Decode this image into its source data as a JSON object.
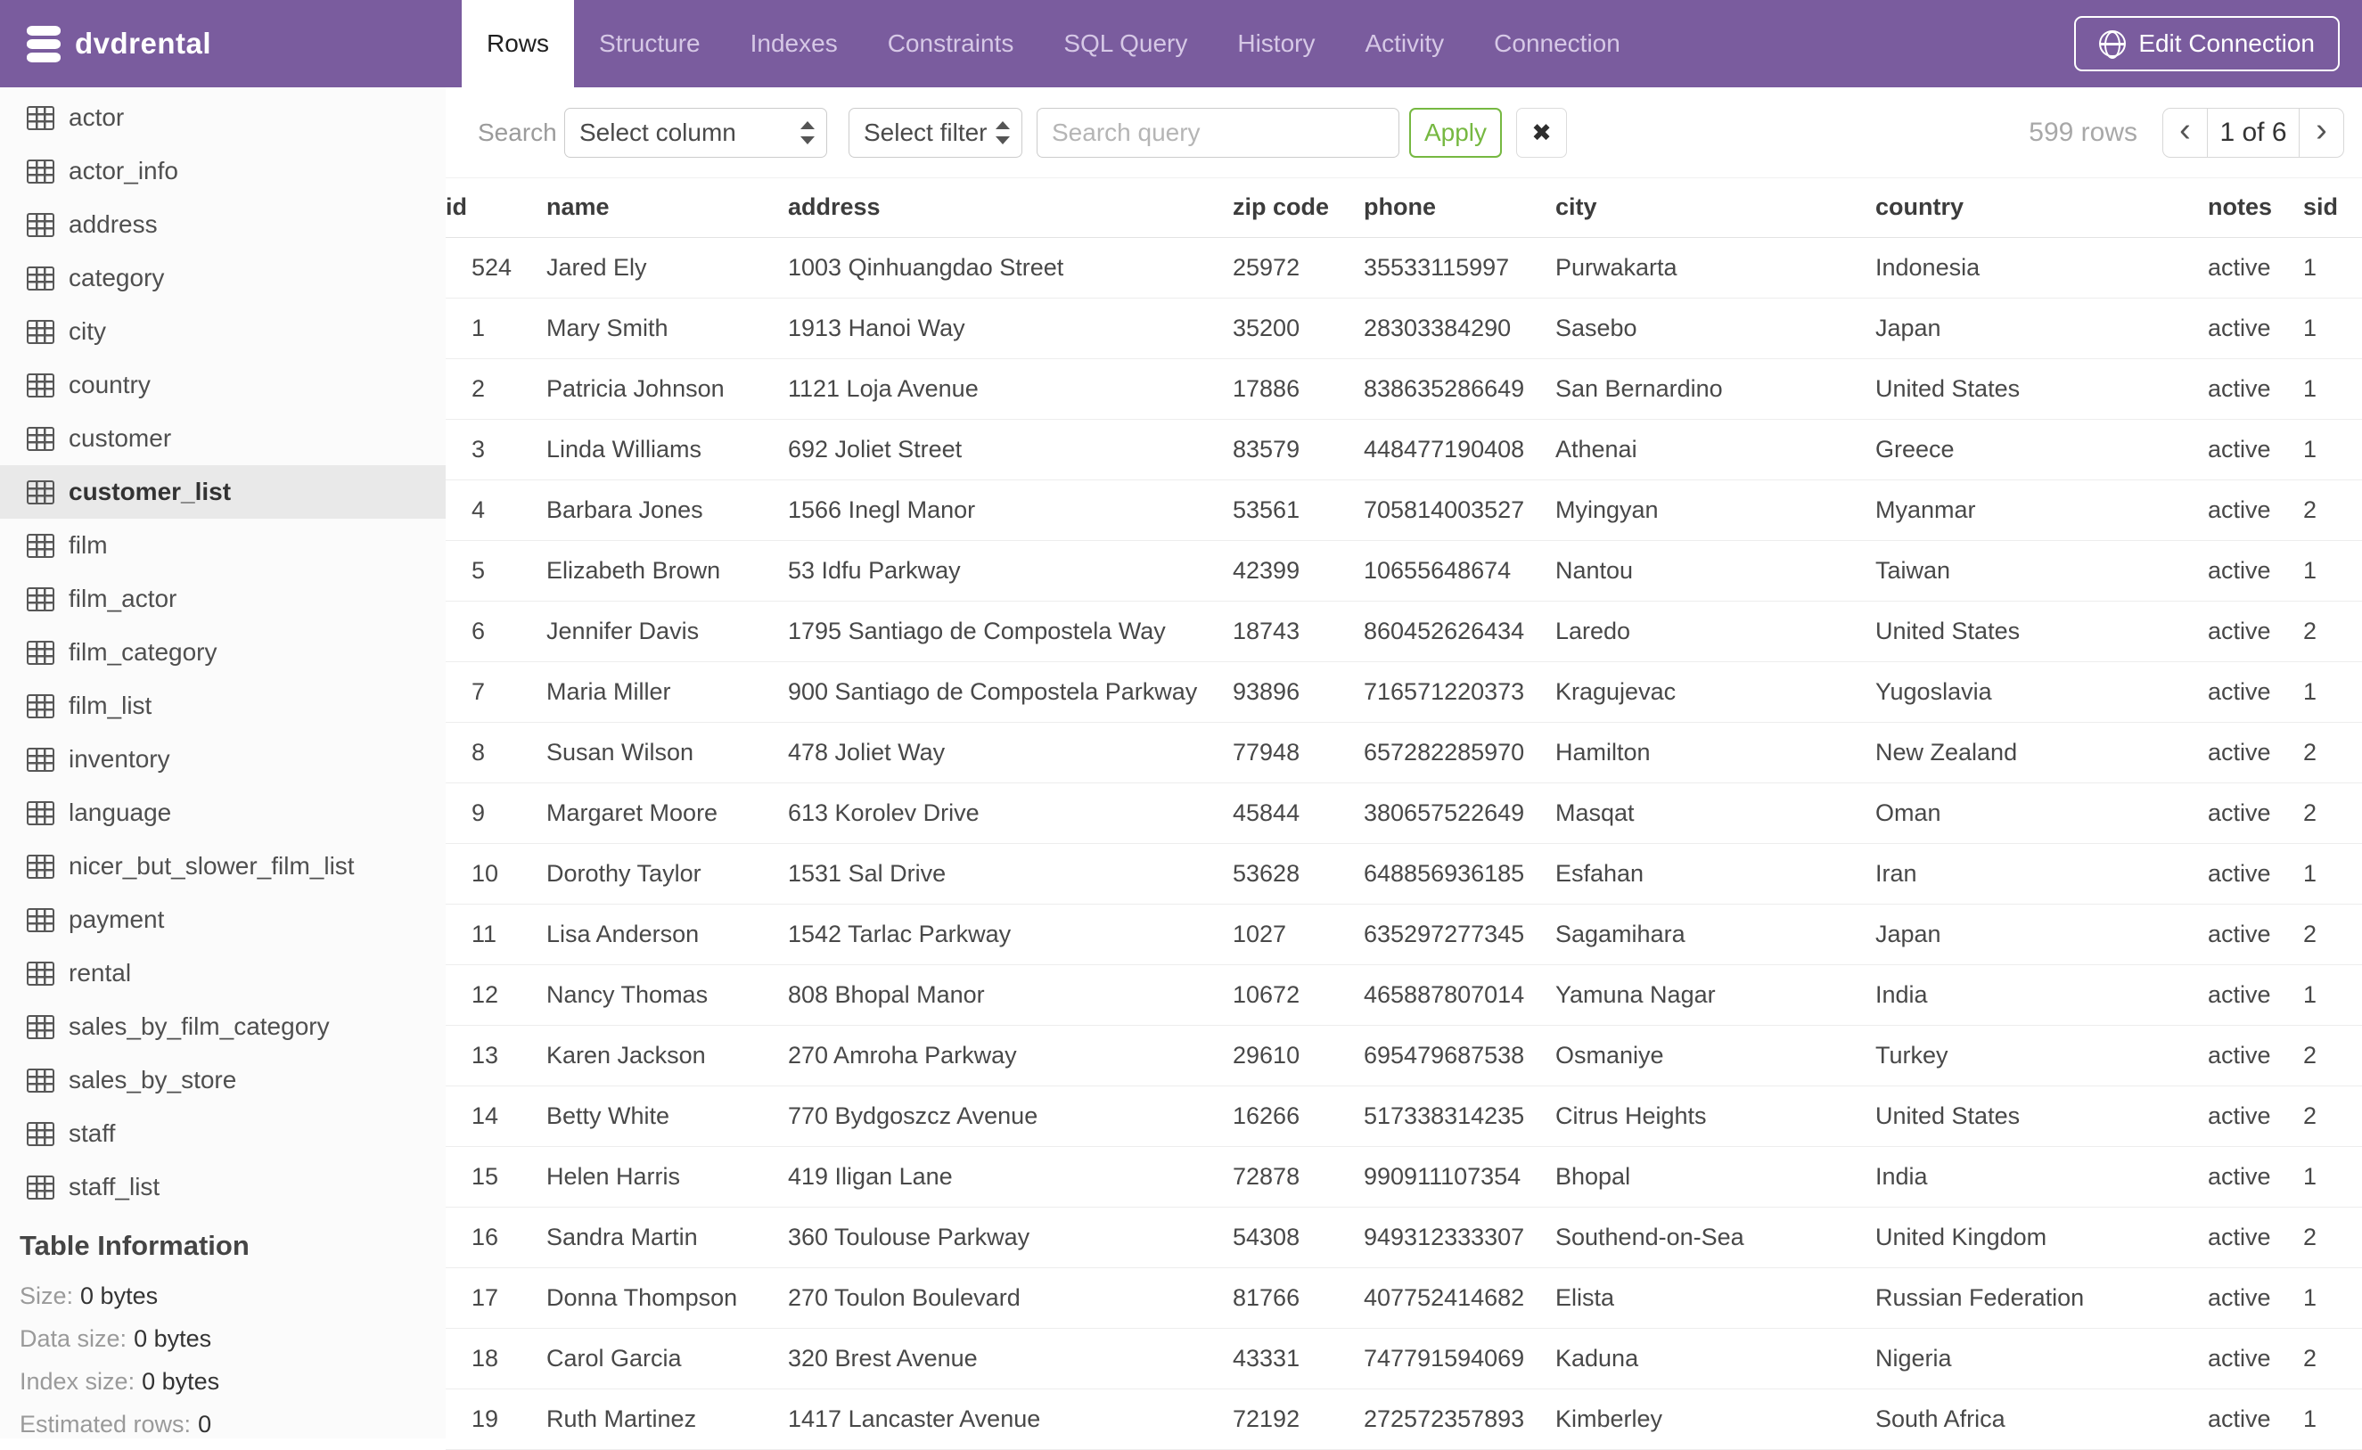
{
  "colors": {
    "header_purple": "#7a5c9e",
    "accent_green": "#76b841"
  },
  "header": {
    "app_title": "dvdrental",
    "tabs": [
      "Rows",
      "Structure",
      "Indexes",
      "Constraints",
      "SQL Query",
      "History",
      "Activity",
      "Connection"
    ],
    "active_tab": "Rows",
    "edit_connection_label": "Edit Connection"
  },
  "sidebar": {
    "tables": [
      "actor",
      "actor_info",
      "address",
      "category",
      "city",
      "country",
      "customer",
      "customer_list",
      "film",
      "film_actor",
      "film_category",
      "film_list",
      "inventory",
      "language",
      "nicer_but_slower_film_list",
      "payment",
      "rental",
      "sales_by_film_category",
      "sales_by_store",
      "staff",
      "staff_list"
    ],
    "selected": "customer_list",
    "table_information": {
      "title": "Table Information",
      "items": [
        {
          "label": "Size:",
          "value": "0 bytes"
        },
        {
          "label": "Data size:",
          "value": "0 bytes"
        },
        {
          "label": "Index size:",
          "value": "0 bytes"
        },
        {
          "label": "Estimated rows:",
          "value": "0"
        }
      ]
    }
  },
  "toolbar": {
    "search_label": "Search",
    "select_column_placeholder": "Select column",
    "select_filter_placeholder": "Select filter",
    "search_query_placeholder": "Search query",
    "apply_label": "Apply",
    "clear_icon": "✖",
    "rows_count": "599 rows",
    "pagination": {
      "prev_icon": "‹",
      "current": "1 of 6",
      "next_icon": "›"
    }
  },
  "table": {
    "columns": [
      "id",
      "name",
      "address",
      "zip code",
      "phone",
      "city",
      "country",
      "notes",
      "sid"
    ],
    "rows": [
      [
        "524",
        "Jared Ely",
        "1003 Qinhuangdao Street",
        "25972",
        "35533115997",
        "Purwakarta",
        "Indonesia",
        "active",
        "1"
      ],
      [
        "1",
        "Mary Smith",
        "1913 Hanoi Way",
        "35200",
        "28303384290",
        "Sasebo",
        "Japan",
        "active",
        "1"
      ],
      [
        "2",
        "Patricia Johnson",
        "1121 Loja Avenue",
        "17886",
        "838635286649",
        "San Bernardino",
        "United States",
        "active",
        "1"
      ],
      [
        "3",
        "Linda Williams",
        "692 Joliet Street",
        "83579",
        "448477190408",
        "Athenai",
        "Greece",
        "active",
        "1"
      ],
      [
        "4",
        "Barbara Jones",
        "1566 Inegl Manor",
        "53561",
        "705814003527",
        "Myingyan",
        "Myanmar",
        "active",
        "2"
      ],
      [
        "5",
        "Elizabeth Brown",
        "53 Idfu Parkway",
        "42399",
        "10655648674",
        "Nantou",
        "Taiwan",
        "active",
        "1"
      ],
      [
        "6",
        "Jennifer Davis",
        "1795 Santiago de Compostela Way",
        "18743",
        "860452626434",
        "Laredo",
        "United States",
        "active",
        "2"
      ],
      [
        "7",
        "Maria Miller",
        "900 Santiago de Compostela Parkway",
        "93896",
        "716571220373",
        "Kragujevac",
        "Yugoslavia",
        "active",
        "1"
      ],
      [
        "8",
        "Susan Wilson",
        "478 Joliet Way",
        "77948",
        "657282285970",
        "Hamilton",
        "New Zealand",
        "active",
        "2"
      ],
      [
        "9",
        "Margaret Moore",
        "613 Korolev Drive",
        "45844",
        "380657522649",
        "Masqat",
        "Oman",
        "active",
        "2"
      ],
      [
        "10",
        "Dorothy Taylor",
        "1531 Sal Drive",
        "53628",
        "648856936185",
        "Esfahan",
        "Iran",
        "active",
        "1"
      ],
      [
        "11",
        "Lisa Anderson",
        "1542 Tarlac Parkway",
        "1027",
        "635297277345",
        "Sagamihara",
        "Japan",
        "active",
        "2"
      ],
      [
        "12",
        "Nancy Thomas",
        "808 Bhopal Manor",
        "10672",
        "465887807014",
        "Yamuna Nagar",
        "India",
        "active",
        "1"
      ],
      [
        "13",
        "Karen Jackson",
        "270 Amroha Parkway",
        "29610",
        "695479687538",
        "Osmaniye",
        "Turkey",
        "active",
        "2"
      ],
      [
        "14",
        "Betty White",
        "770 Bydgoszcz Avenue",
        "16266",
        "517338314235",
        "Citrus Heights",
        "United States",
        "active",
        "2"
      ],
      [
        "15",
        "Helen Harris",
        "419 Iligan Lane",
        "72878",
        "990911107354",
        "Bhopal",
        "India",
        "active",
        "1"
      ],
      [
        "16",
        "Sandra Martin",
        "360 Toulouse Parkway",
        "54308",
        "949312333307",
        "Southend-on-Sea",
        "United Kingdom",
        "active",
        "2"
      ],
      [
        "17",
        "Donna Thompson",
        "270 Toulon Boulevard",
        "81766",
        "407752414682",
        "Elista",
        "Russian Federation",
        "active",
        "1"
      ],
      [
        "18",
        "Carol Garcia",
        "320 Brest Avenue",
        "43331",
        "747791594069",
        "Kaduna",
        "Nigeria",
        "active",
        "2"
      ],
      [
        "19",
        "Ruth Martinez",
        "1417 Lancaster Avenue",
        "72192",
        "272572357893",
        "Kimberley",
        "South Africa",
        "active",
        "1"
      ]
    ]
  }
}
